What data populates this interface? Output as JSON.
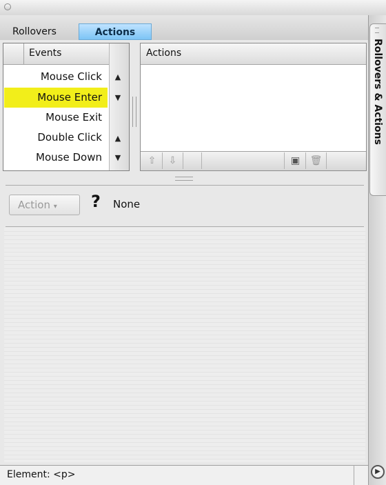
{
  "tabs": [
    {
      "label": "Rollovers",
      "active": false
    },
    {
      "label": "Actions",
      "active": true
    }
  ],
  "events": {
    "header": "Events",
    "items": [
      {
        "label": "Mouse Click",
        "selected": false
      },
      {
        "label": "Mouse Enter",
        "selected": true
      },
      {
        "label": "Mouse Exit",
        "selected": false
      },
      {
        "label": "Double Click",
        "selected": false
      },
      {
        "label": "Mouse Down",
        "selected": false
      }
    ],
    "selected_color": "#f2ee1a"
  },
  "actions_list": {
    "header": "Actions",
    "toolbar_icons": [
      "move-up-icon",
      "move-down-icon",
      "save-icon",
      "trash-icon"
    ]
  },
  "action_row": {
    "button_label": "Action",
    "help_symbol": "?",
    "value": "None"
  },
  "status": {
    "text": "Element: <p>"
  },
  "side_tab": {
    "label": "Rollovers & Actions"
  },
  "colors": {
    "accent_tab": "#7cc4f5",
    "highlight": "#f2ee1a"
  }
}
